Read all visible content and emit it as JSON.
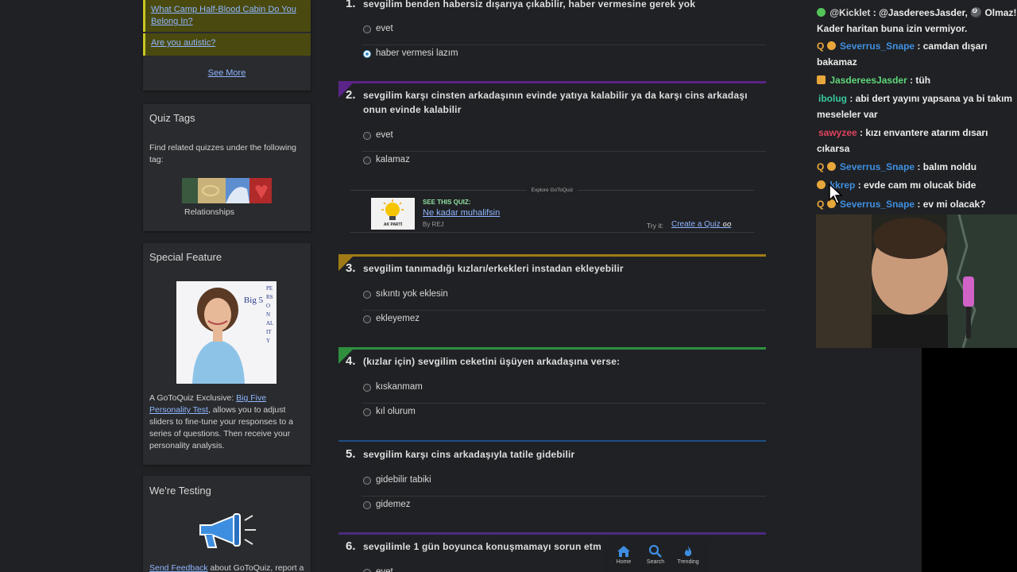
{
  "sidebar": {
    "popular_links": [
      "What Camp Half-Blood Cabin Do You Belong In?",
      "Are you autistic?"
    ],
    "see_more": "See More",
    "tags_card": {
      "title": "Quiz Tags",
      "text": "Find related quizzes under the following tag:",
      "tag_label": "Relationships"
    },
    "special_card": {
      "title": "Special Feature",
      "image_text": "Big 5",
      "image_side_text": "PERSONALITY",
      "desc_prefix": "A GoToQuiz Exclusive: ",
      "desc_link": "Big Five Personality Test",
      "desc_suffix": ", allows you to adjust sliders to fine-tune your responses to a series of questions. Then receive your personality analysis."
    },
    "testing_card": {
      "title": "We're Testing",
      "feedback_link": "Send Feedback",
      "feedback_suffix": " about GoToQuiz, report a"
    }
  },
  "questions": [
    {
      "num": "1.",
      "text": "sevgilim benden habersiz dışarıya çıkabilir, haber vermesine gerek yok",
      "color": "#6b2fa0",
      "options": [
        "evet",
        "haber vermesi lazım"
      ],
      "selected": 1
    },
    {
      "num": "2.",
      "text": "sevgilim karşı cinsten arkadaşının evinde yatıya kalabilir ya da karşı cins arkadaşı onun evinde kalabilir",
      "color": "#5a2488",
      "options": [
        "evet",
        "kalamaz"
      ],
      "selected": -1
    },
    {
      "num": "3.",
      "text": "sevgilim tanımadığı kızları/erkekleri instadan ekleyebilir",
      "color": "#a07a16",
      "options": [
        "sıkıntı yok eklesin",
        "ekleyemez"
      ],
      "selected": -1
    },
    {
      "num": "4.",
      "text": "(kızlar için) sevgilim ceketini üşüyen arkadaşına verse:",
      "color": "#2f8f3f",
      "options": [
        "kıskanmam",
        "kıl olurum"
      ],
      "selected": -1
    },
    {
      "num": "5.",
      "text": "sevgilim karşı cins arkadaşıyla tatile gidebilir",
      "color": "#1e4d86",
      "options": [
        "gidebilir tabiki",
        "gidemez"
      ],
      "selected": -1
    },
    {
      "num": "6.",
      "text": "sevgilimle 1 gün boyunca konuşmamayı sorun etm",
      "color": "#4a2a80",
      "options": [
        "evet"
      ],
      "selected": -1
    }
  ],
  "promo": {
    "explore": "Explore GoToQuiz",
    "see_this": "SEE THIS QUIZ:",
    "quiz_title": "Ne kadar muhalifsin",
    "by": "By REJ",
    "try_it": "Try it:",
    "create": "Create a Quiz",
    "create_badge": "GO",
    "logo_caption": "AK PARTİ"
  },
  "bottom_nav": [
    {
      "label": "Home",
      "icon": "home-icon"
    },
    {
      "label": "Search",
      "icon": "search-icon"
    },
    {
      "label": "Trending",
      "icon": "flame-icon"
    }
  ],
  "chat": [
    {
      "user": "@Kicklet",
      "color": "#d9d9d9",
      "msg": " : @JasdereesJasder, 🎱 Olmaz! Kader haritan buna izin vermiyor.",
      "badges": [
        "green"
      ]
    },
    {
      "user": "Severrus_Snape",
      "color": "#3f8fe0",
      "msg": " : camdan dışarı bakamaz",
      "badges": [
        "q",
        "orange"
      ]
    },
    {
      "user": "JasdereesJasder",
      "color": "#5fd67a",
      "msg": " : tüh",
      "badges": [
        "crown"
      ]
    },
    {
      "user": "ibolug",
      "color": "#37c9a0",
      "msg": " : abi dert yayını yapsana ya bi takım meseleler var",
      "badges": []
    },
    {
      "user": "sawyzee",
      "color": "#e0435f",
      "msg": " : kızı envantere atarım dısarı cıkarsa",
      "badges": []
    },
    {
      "user": "Severrus_Snape",
      "color": "#3f8fe0",
      "msg": " : balım noldu",
      "badges": [
        "q",
        "orange"
      ]
    },
    {
      "user": "kkrep",
      "color": "#3f8fe0",
      "msg": " : evde cam mı olucak bide",
      "badges": [
        "orange"
      ]
    },
    {
      "user": "Severrus_Snape",
      "color": "#3f8fe0",
      "msg": " : ev mi olacak?",
      "badges": [
        "q",
        "orange"
      ]
    }
  ]
}
